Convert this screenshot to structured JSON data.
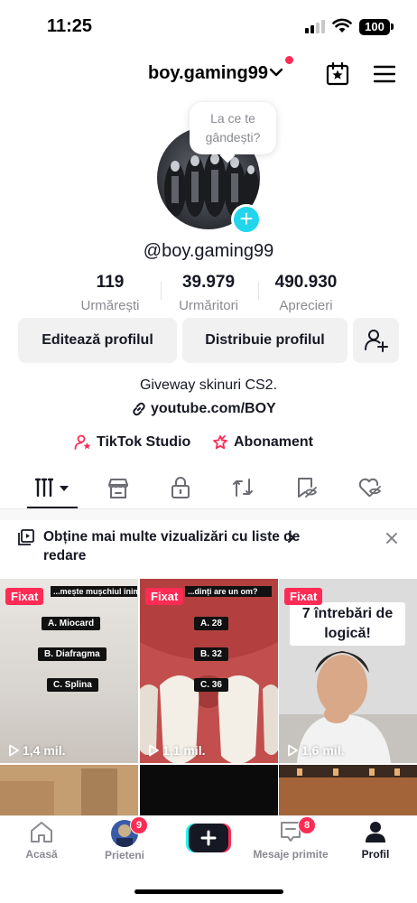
{
  "status_bar": {
    "time": "11:25",
    "battery": "100"
  },
  "header": {
    "username": "boy.gaming99"
  },
  "profile": {
    "bubble_text_line1": "La ce te",
    "bubble_text_line2": "gândești?",
    "handle": "@boy.gaming99",
    "stats": [
      {
        "value": "119",
        "label": "Urmărești"
      },
      {
        "value": "39.979",
        "label": "Urmăritori"
      },
      {
        "value": "490.930",
        "label": "Aprecieri"
      }
    ],
    "edit_button": "Editează profilul",
    "share_button": "Distribuie profilul",
    "bio": "Giveway skinuri CS2.",
    "link": "youtube.com/BOY",
    "studio": "TikTok Studio",
    "subscription": "Abonament"
  },
  "promo": {
    "text": "Obține mai multe vizualizări cu liste de redare"
  },
  "videos": [
    {
      "pinned": "Fixat",
      "views": "1,4 mil.",
      "question": "...mește mușchiul inimii?",
      "options": [
        "A. Miocard",
        "B. Diafragma",
        "C. Splina"
      ]
    },
    {
      "pinned": "Fixat",
      "views": "1,1 mil.",
      "question": "...dinți are un om?",
      "options": [
        "A. 28",
        "B. 32",
        "C. 36"
      ]
    },
    {
      "pinned": "Fixat",
      "views": "1,6 mil.",
      "caption_line1": "7 întrebări de",
      "caption_line2": "logică!"
    }
  ],
  "bottom_nav": {
    "home": "Acasă",
    "friends": "Prieteni",
    "friends_badge": "9",
    "inbox": "Mesaje primite",
    "inbox_badge": "8",
    "profile": "Profil"
  },
  "colors": {
    "accent": "#fe2c55",
    "cyan": "#20d5ec",
    "text": "#161823",
    "secondary": "#8a8b91"
  }
}
